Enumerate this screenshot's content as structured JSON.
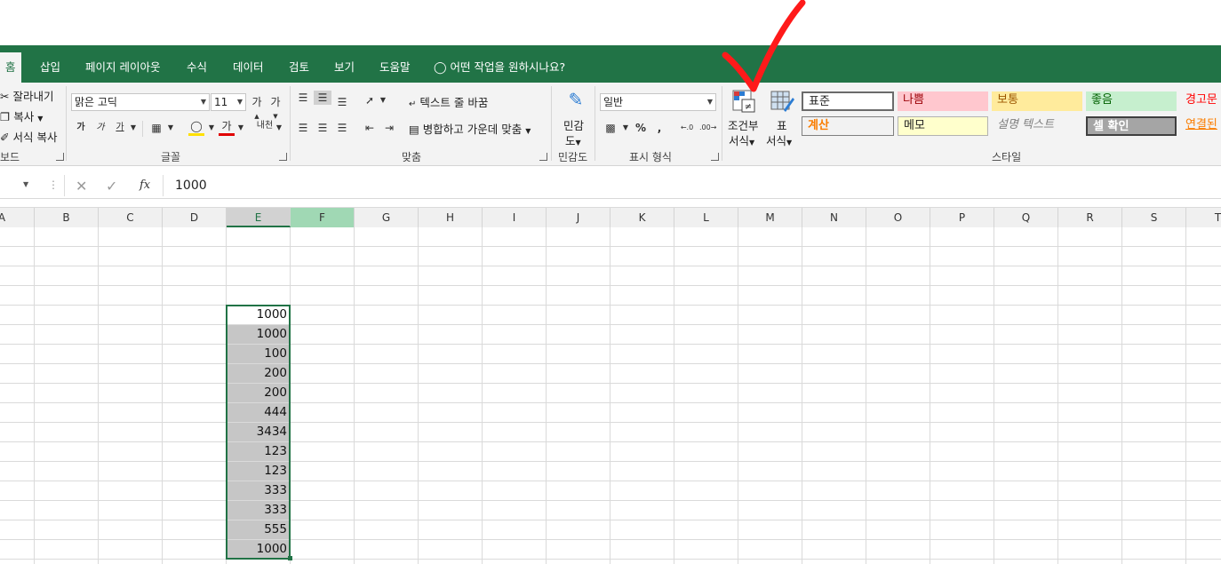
{
  "tabs": [
    "홈",
    "삽입",
    "페이지 레이아웃",
    "수식",
    "데이터",
    "검토",
    "보기",
    "도움말"
  ],
  "tell_me": "어떤 작업을 원하시나요?",
  "clipboard": {
    "cut": "잘라내기",
    "copy": "복사",
    "format_painter": "서식 복사",
    "label": "보드"
  },
  "font": {
    "name": "맑은 고딕",
    "size": "11",
    "label": "글꼴"
  },
  "alignment": {
    "wrap": "텍스트 줄 바꿈",
    "merge": "병합하고 가운데 맞춤",
    "label": "맞춤"
  },
  "sensitivity": {
    "line1": "민감",
    "line2": "도",
    "label": "민감도"
  },
  "number": {
    "format": "일반",
    "label": "표시 형식"
  },
  "styles": {
    "conditional_line1": "조건부",
    "conditional_line2": "서식",
    "table_line1": "표",
    "table_line2": "서식",
    "label": "스타일",
    "cells": [
      "표준",
      "나쁨",
      "보통",
      "좋음",
      "경고문",
      "계산",
      "메모",
      "설명 텍스트",
      "셀 확인",
      "연결된"
    ]
  },
  "formula_bar": {
    "value": "1000",
    "fx": "fx"
  },
  "columns": [
    "A",
    "B",
    "C",
    "D",
    "E",
    "F",
    "G",
    "H",
    "I",
    "J",
    "K",
    "L",
    "M",
    "N",
    "O",
    "P",
    "Q",
    "R",
    "S",
    "T"
  ],
  "selected_column": "E",
  "cell_values": [
    "1000",
    "1000",
    "100",
    "200",
    "200",
    "444",
    "3434",
    "123",
    "123",
    "333",
    "333",
    "555",
    "1000"
  ],
  "accent": "#217346",
  "annotation": "red-checkmark"
}
